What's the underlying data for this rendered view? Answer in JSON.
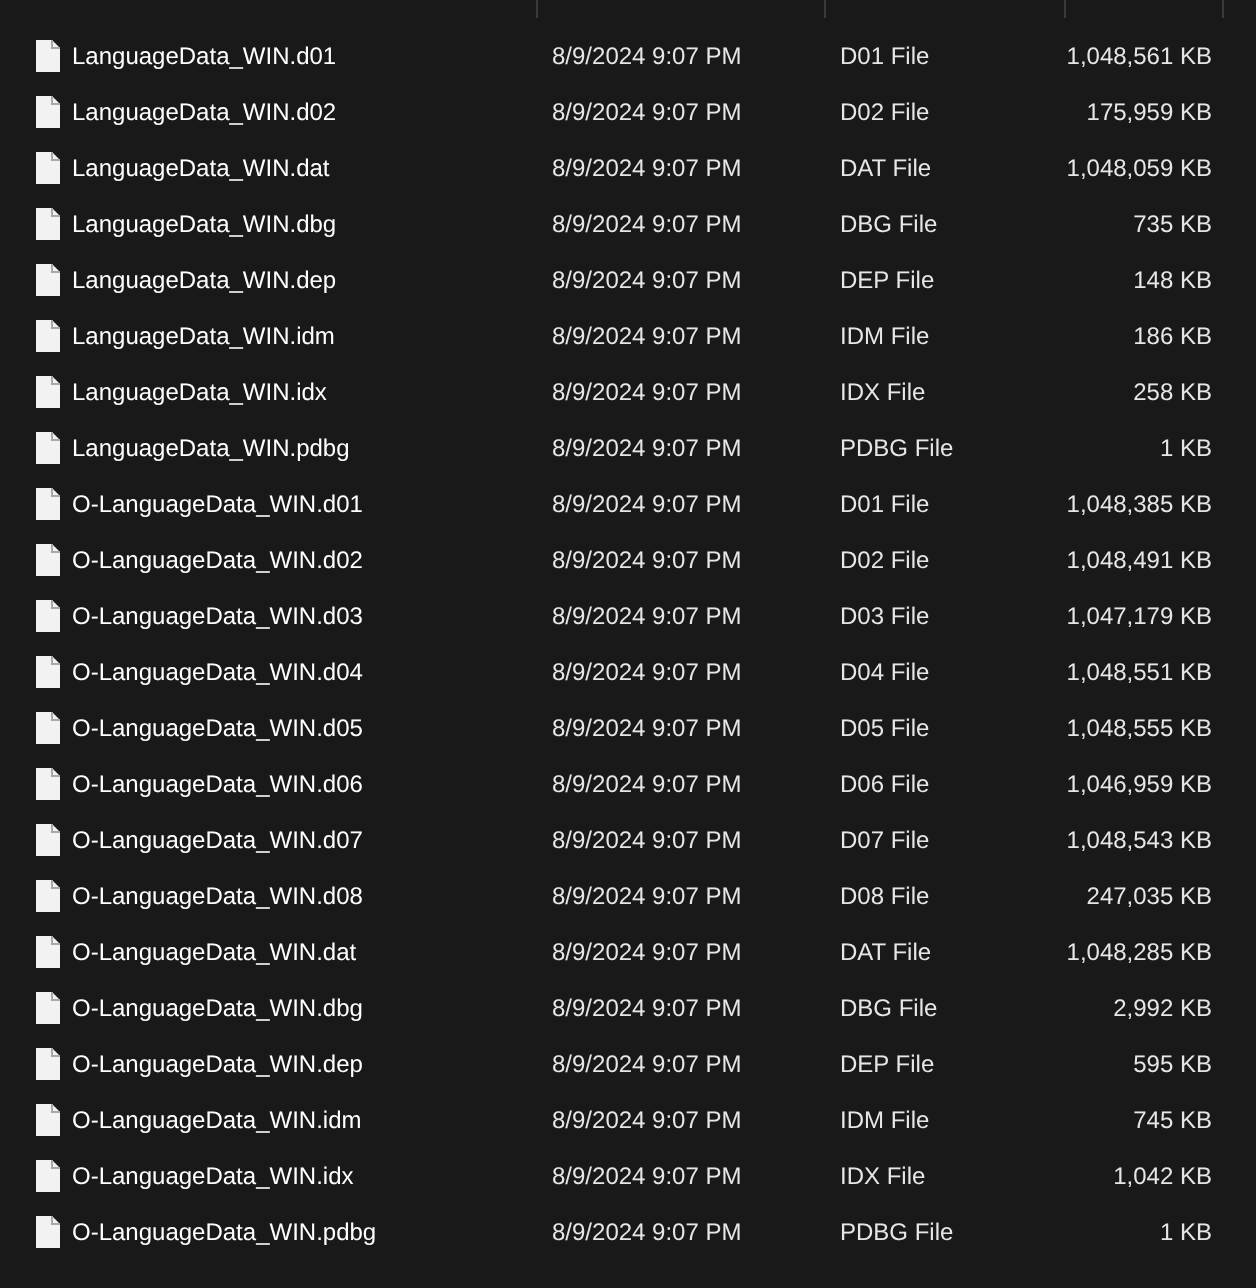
{
  "files": [
    {
      "name": "LanguageData_WIN.d01",
      "date_modified": "8/9/2024 9:07 PM",
      "type": "D01 File",
      "size": "1,048,561 KB"
    },
    {
      "name": "LanguageData_WIN.d02",
      "date_modified": "8/9/2024 9:07 PM",
      "type": "D02 File",
      "size": "175,959 KB"
    },
    {
      "name": "LanguageData_WIN.dat",
      "date_modified": "8/9/2024 9:07 PM",
      "type": "DAT File",
      "size": "1,048,059 KB"
    },
    {
      "name": "LanguageData_WIN.dbg",
      "date_modified": "8/9/2024 9:07 PM",
      "type": "DBG File",
      "size": "735 KB"
    },
    {
      "name": "LanguageData_WIN.dep",
      "date_modified": "8/9/2024 9:07 PM",
      "type": "DEP File",
      "size": "148 KB"
    },
    {
      "name": "LanguageData_WIN.idm",
      "date_modified": "8/9/2024 9:07 PM",
      "type": "IDM File",
      "size": "186 KB"
    },
    {
      "name": "LanguageData_WIN.idx",
      "date_modified": "8/9/2024 9:07 PM",
      "type": "IDX File",
      "size": "258 KB"
    },
    {
      "name": "LanguageData_WIN.pdbg",
      "date_modified": "8/9/2024 9:07 PM",
      "type": "PDBG File",
      "size": "1 KB"
    },
    {
      "name": "O-LanguageData_WIN.d01",
      "date_modified": "8/9/2024 9:07 PM",
      "type": "D01 File",
      "size": "1,048,385 KB"
    },
    {
      "name": "O-LanguageData_WIN.d02",
      "date_modified": "8/9/2024 9:07 PM",
      "type": "D02 File",
      "size": "1,048,491 KB"
    },
    {
      "name": "O-LanguageData_WIN.d03",
      "date_modified": "8/9/2024 9:07 PM",
      "type": "D03 File",
      "size": "1,047,179 KB"
    },
    {
      "name": "O-LanguageData_WIN.d04",
      "date_modified": "8/9/2024 9:07 PM",
      "type": "D04 File",
      "size": "1,048,551 KB"
    },
    {
      "name": "O-LanguageData_WIN.d05",
      "date_modified": "8/9/2024 9:07 PM",
      "type": "D05 File",
      "size": "1,048,555 KB"
    },
    {
      "name": "O-LanguageData_WIN.d06",
      "date_modified": "8/9/2024 9:07 PM",
      "type": "D06 File",
      "size": "1,046,959 KB"
    },
    {
      "name": "O-LanguageData_WIN.d07",
      "date_modified": "8/9/2024 9:07 PM",
      "type": "D07 File",
      "size": "1,048,543 KB"
    },
    {
      "name": "O-LanguageData_WIN.d08",
      "date_modified": "8/9/2024 9:07 PM",
      "type": "D08 File",
      "size": "247,035 KB"
    },
    {
      "name": "O-LanguageData_WIN.dat",
      "date_modified": "8/9/2024 9:07 PM",
      "type": "DAT File",
      "size": "1,048,285 KB"
    },
    {
      "name": "O-LanguageData_WIN.dbg",
      "date_modified": "8/9/2024 9:07 PM",
      "type": "DBG File",
      "size": "2,992 KB"
    },
    {
      "name": "O-LanguageData_WIN.dep",
      "date_modified": "8/9/2024 9:07 PM",
      "type": "DEP File",
      "size": "595 KB"
    },
    {
      "name": "O-LanguageData_WIN.idm",
      "date_modified": "8/9/2024 9:07 PM",
      "type": "IDM File",
      "size": "745 KB"
    },
    {
      "name": "O-LanguageData_WIN.idx",
      "date_modified": "8/9/2024 9:07 PM",
      "type": "IDX File",
      "size": "1,042 KB"
    },
    {
      "name": "O-LanguageData_WIN.pdbg",
      "date_modified": "8/9/2024 9:07 PM",
      "type": "PDBG File",
      "size": "1 KB"
    }
  ]
}
